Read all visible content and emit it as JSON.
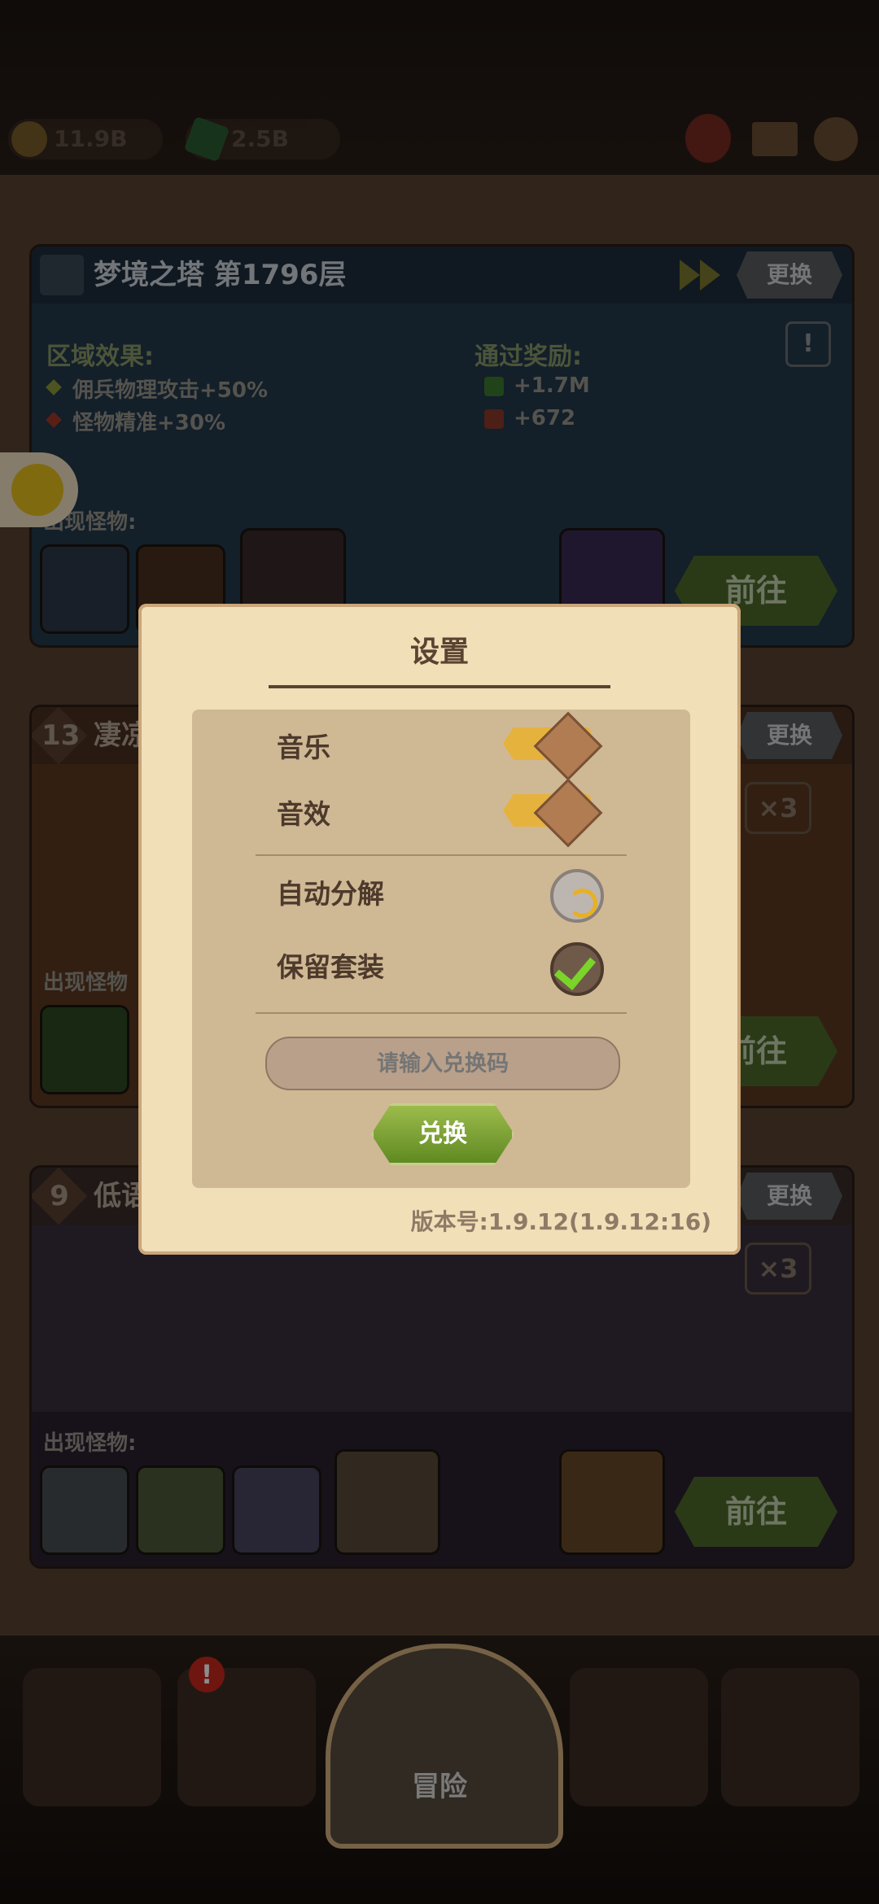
{
  "top_bar": {
    "gold": "11.9B",
    "gems": "2.5B"
  },
  "tower_card": {
    "title": "梦境之塔 第1796层",
    "change_label": "更换",
    "zone_effects_title": "区域效果:",
    "effects": [
      "佣兵物理攻击+50%",
      "怪物精准+30%"
    ],
    "rewards_title": "通过奖励:",
    "rewards": [
      "+1.7M",
      "+672"
    ],
    "monsters_label": "出现怪物:",
    "go_label": "前往"
  },
  "card2": {
    "level": "13",
    "title": "凄凉",
    "change_label": "更换",
    "multiplier": "×3",
    "monsters_label": "出现怪物",
    "go_label": "前往"
  },
  "card3": {
    "level": "9",
    "title": "低语",
    "change_label": "更换",
    "multiplier": "×3",
    "monsters_label": "出现怪物:",
    "go_label": "前往"
  },
  "settings": {
    "title": "设置",
    "music_label": "音乐",
    "sfx_label": "音效",
    "auto_decompose_label": "自动分解",
    "keep_set_label": "保留套装",
    "code_placeholder": "请输入兑换码",
    "redeem_label": "兑换",
    "version": "版本号:1.9.12(1.9.12:16)"
  },
  "bottom_nav": {
    "adventure_label": "冒险",
    "alert": "!"
  },
  "colors": {
    "accent_gold": "#e6b23e",
    "redeem_green": "#6f9a2c",
    "parchment": "#f1dfb8"
  }
}
